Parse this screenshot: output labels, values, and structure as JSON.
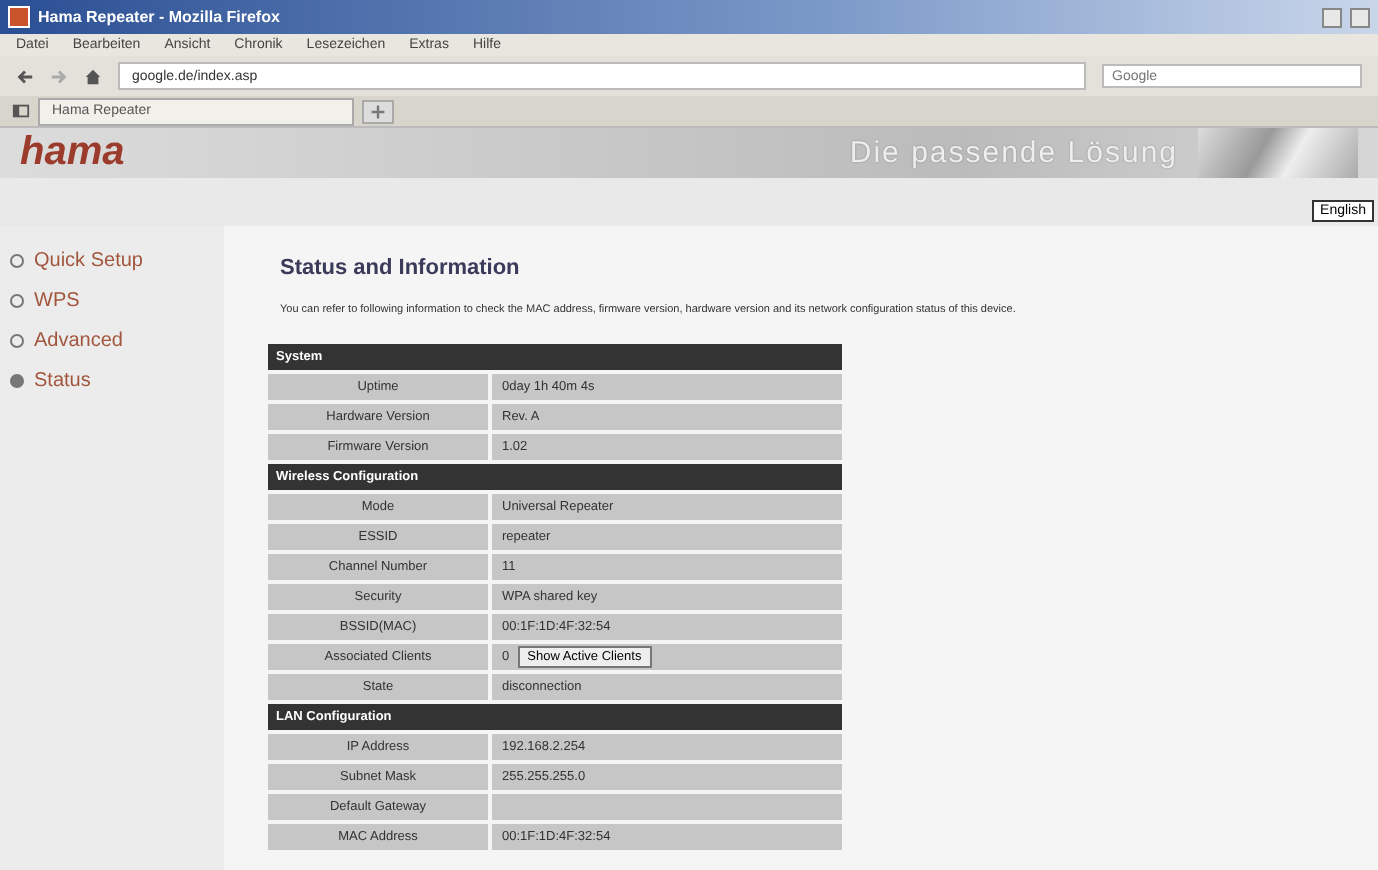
{
  "window": {
    "title": "Hama Repeater - Mozilla Firefox"
  },
  "menu": [
    "Datei",
    "Bearbeiten",
    "Ansicht",
    "Chronik",
    "Lesezeichen",
    "Extras",
    "Hilfe"
  ],
  "address_bar": {
    "value": "google.de/index.asp"
  },
  "search": {
    "placeholder": "Google"
  },
  "tabs": [
    {
      "label": "Hama Repeater",
      "selected": true
    }
  ],
  "header": {
    "logo": "hama",
    "slogan": "Die passende Lösung",
    "language": "English"
  },
  "sidebar": {
    "items": [
      {
        "label": "Quick Setup",
        "selected": false
      },
      {
        "label": "WPS",
        "selected": false
      },
      {
        "label": "Advanced",
        "selected": false
      },
      {
        "label": "Status",
        "selected": true
      }
    ]
  },
  "content": {
    "title": "Status and Information",
    "description": "You can refer to following information to check the MAC address, firmware version, hardware version and its network configuration status of this device.",
    "table": [
      {
        "kind": "section",
        "label": "System"
      },
      {
        "kind": "row",
        "label": "Uptime",
        "value": "0day 1h 40m 4s"
      },
      {
        "kind": "row",
        "label": "Hardware Version",
        "value": "Rev. A"
      },
      {
        "kind": "row",
        "label": "Firmware Version",
        "value": "1.02"
      },
      {
        "kind": "section",
        "label": "Wireless Configuration"
      },
      {
        "kind": "row",
        "label": "Mode",
        "value": "Universal Repeater"
      },
      {
        "kind": "row",
        "label": "ESSID",
        "value": "repeater"
      },
      {
        "kind": "row",
        "label": "Channel Number",
        "value": "11"
      },
      {
        "kind": "row",
        "label": "Security",
        "value": "WPA shared key"
      },
      {
        "kind": "row",
        "label": "BSSID(MAC)",
        "value": "00:1F:1D:4F:32:54"
      },
      {
        "kind": "button_row",
        "label": "Associated Clients",
        "value": "0",
        "button": "Show Active Clients"
      },
      {
        "kind": "row",
        "label": "State",
        "value": "disconnection"
      },
      {
        "kind": "section",
        "label": "LAN Configuration"
      },
      {
        "kind": "row",
        "label": "IP Address",
        "value": "192.168.2.254"
      },
      {
        "kind": "row",
        "label": "Subnet Mask",
        "value": "255.255.255.0"
      },
      {
        "kind": "row",
        "label": "Default Gateway"
      },
      {
        "kind": "row",
        "label": "MAC Address",
        "value": "00:1F:1D:4F:32:54"
      }
    ]
  }
}
